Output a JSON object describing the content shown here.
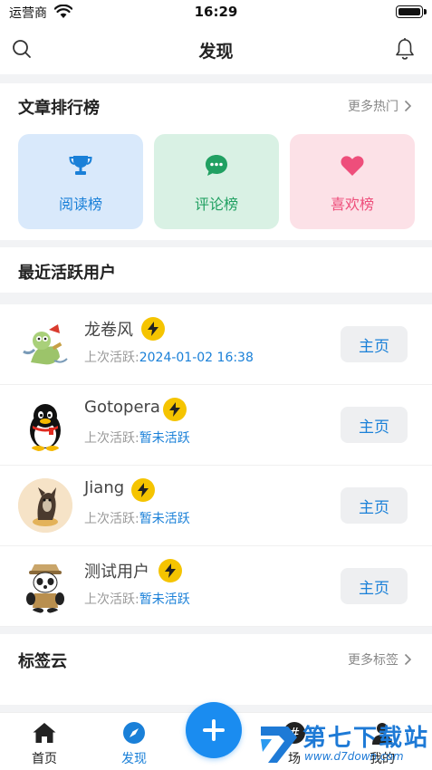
{
  "status_bar": {
    "carrier": "运营商",
    "time": "16:29"
  },
  "nav": {
    "title": "发现"
  },
  "ranking": {
    "title": "文章排行榜",
    "more": "更多热门",
    "tiles": [
      {
        "label": "阅读榜",
        "icon": "trophy-icon"
      },
      {
        "label": "评论榜",
        "icon": "chat-bubble-icon"
      },
      {
        "label": "喜欢榜",
        "icon": "heart-icon"
      }
    ]
  },
  "active_users": {
    "title": "最近活跃用户",
    "active_prefix": "上次活跃:",
    "button_label": "主页",
    "users": [
      {
        "name": "龙卷风",
        "last_active": "2024-01-02 16:38"
      },
      {
        "name": "Gotopera",
        "last_active": "暂未活跃"
      },
      {
        "name": "Jiang",
        "last_active": "暂未活跃"
      },
      {
        "name": "测试用户",
        "last_active": "暂未活跃"
      }
    ]
  },
  "tag_cloud": {
    "title": "标签云",
    "more": "更多标签"
  },
  "tabbar": {
    "tabs": [
      {
        "label": "首页",
        "icon": "home-icon"
      },
      {
        "label": "发现",
        "icon": "compass-icon"
      },
      {
        "label": "场",
        "icon": "hash-icon"
      },
      {
        "label": "我的",
        "icon": "profile-icon"
      }
    ],
    "fab_icon": "plus-icon"
  },
  "watermark": {
    "title": "第七下载站",
    "url": "www.d7down.com"
  },
  "colors": {
    "accent": "#1a80d8",
    "badge": "#f5c400",
    "read": "#d9e9fb",
    "comment": "#d9f1e4",
    "like": "#fce1e7"
  }
}
